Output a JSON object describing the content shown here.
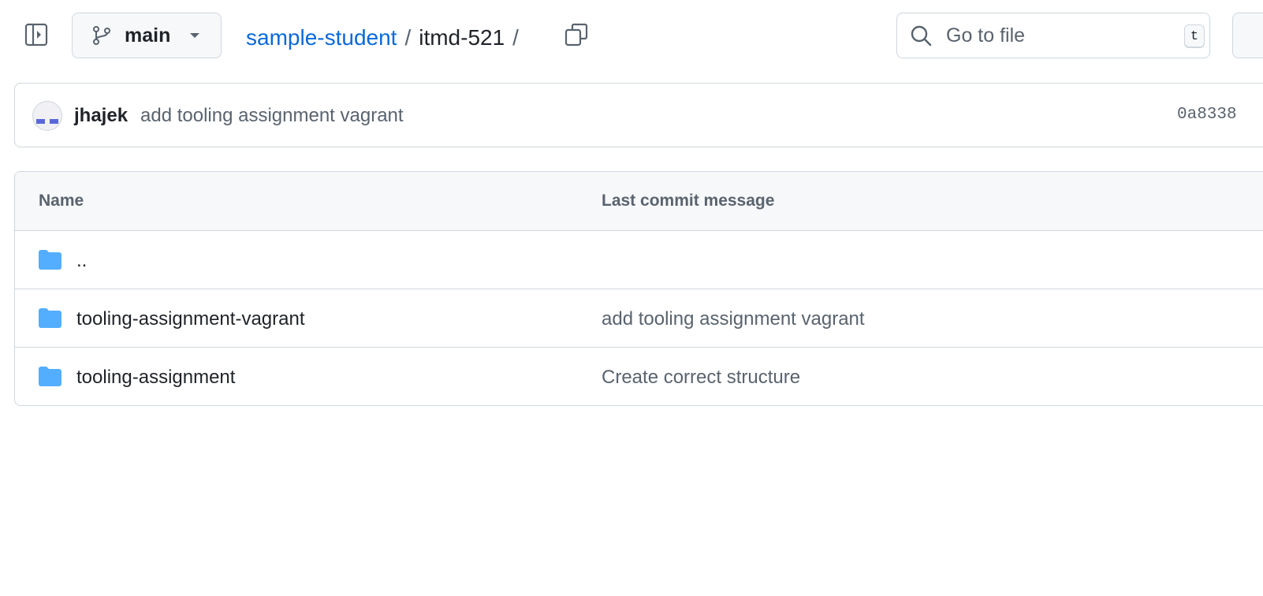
{
  "header": {
    "branch": "main",
    "breadcrumb": {
      "repo": "sample-student",
      "separator": "/",
      "directory": "itmd-521",
      "trailing_separator": "/"
    },
    "search": {
      "placeholder": "Go to file",
      "shortcut": "t"
    }
  },
  "commit": {
    "author": "jhajek",
    "message": "add tooling assignment vagrant",
    "hash": "0a8338"
  },
  "file_table": {
    "columns": [
      "Name",
      "Last commit message"
    ],
    "rows": [
      {
        "name": "..",
        "message": "",
        "icon": "folder-icon"
      },
      {
        "name": "tooling-assignment-vagrant",
        "message": "add tooling assignment vagrant",
        "icon": "folder-icon"
      },
      {
        "name": "tooling-assignment",
        "message": "Create correct structure",
        "icon": "folder-icon"
      }
    ]
  },
  "colors": {
    "link": "#0969da",
    "folder": "#54aeff",
    "border": "#d0d7de",
    "muted_text": "#59636e",
    "avatar_accent": "#5968d8"
  }
}
